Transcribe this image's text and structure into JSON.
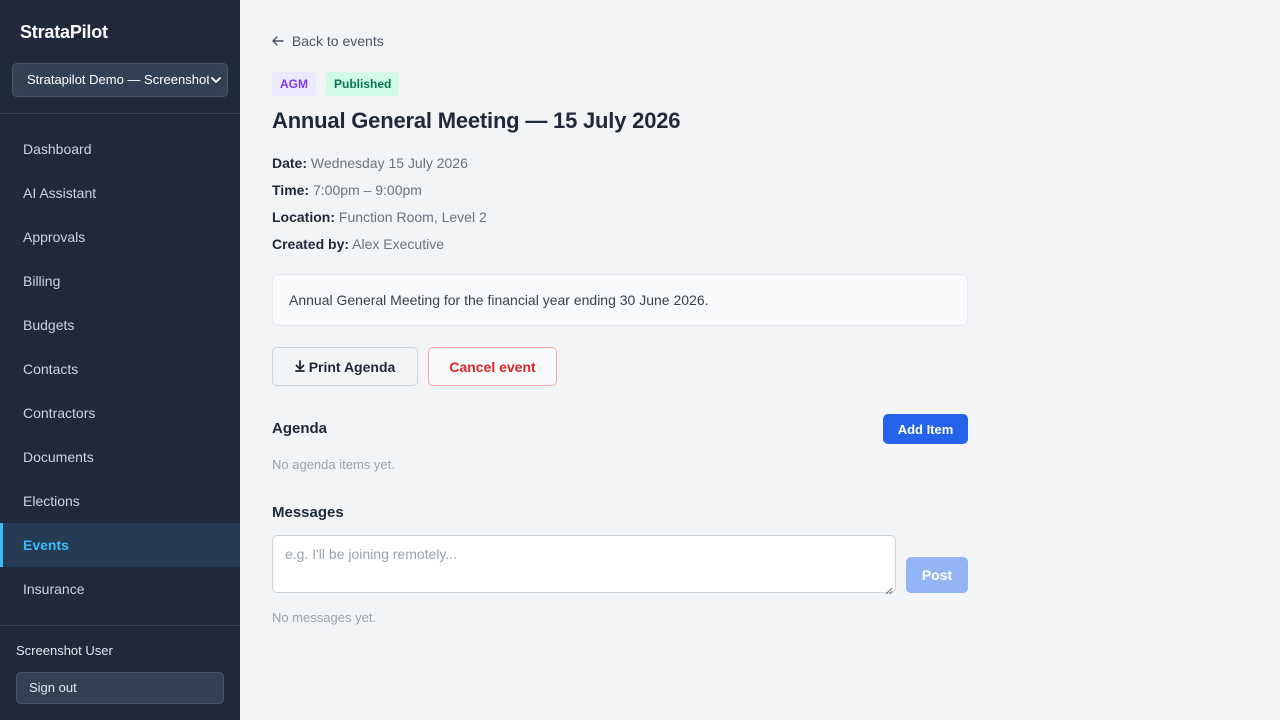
{
  "app": {
    "name": "StrataPilot"
  },
  "sidebar": {
    "org_selected": "Stratapilot Demo — Screenshot",
    "items": [
      {
        "label": "Dashboard",
        "active": false
      },
      {
        "label": "AI Assistant",
        "active": false
      },
      {
        "label": "Approvals",
        "active": false
      },
      {
        "label": "Billing",
        "active": false
      },
      {
        "label": "Budgets",
        "active": false
      },
      {
        "label": "Contacts",
        "active": false
      },
      {
        "label": "Contractors",
        "active": false
      },
      {
        "label": "Documents",
        "active": false
      },
      {
        "label": "Elections",
        "active": false
      },
      {
        "label": "Events",
        "active": true
      },
      {
        "label": "Insurance",
        "active": false
      }
    ],
    "user_name": "Screenshot User",
    "sign_out_label": "Sign out"
  },
  "event": {
    "back_label": "Back to events",
    "type_badge": "AGM",
    "status_badge": "Published",
    "title": "Annual General Meeting — 15 July 2026",
    "meta": [
      {
        "label": "Date:",
        "value": "Wednesday 15 July 2026"
      },
      {
        "label": "Time:",
        "value": "7:00pm – 9:00pm"
      },
      {
        "label": "Location:",
        "value": "Function Room, Level 2"
      },
      {
        "label": "Created by:",
        "value": "Alex Executive"
      }
    ],
    "description": "Annual General Meeting for the financial year ending 30 June 2026.",
    "print_label": "Print Agenda",
    "cancel_label": "Cancel event"
  },
  "agenda": {
    "heading": "Agenda",
    "add_label": "Add Item",
    "empty_text": "No agenda items yet."
  },
  "messages": {
    "heading": "Messages",
    "placeholder": "e.g. I'll be joining remotely...",
    "post_label": "Post",
    "empty_text": "No messages yet."
  },
  "colors": {
    "sidebar_bg": "#1e293b",
    "accent": "#38bdf8",
    "primary": "#2563eb",
    "danger": "#dc2626"
  }
}
